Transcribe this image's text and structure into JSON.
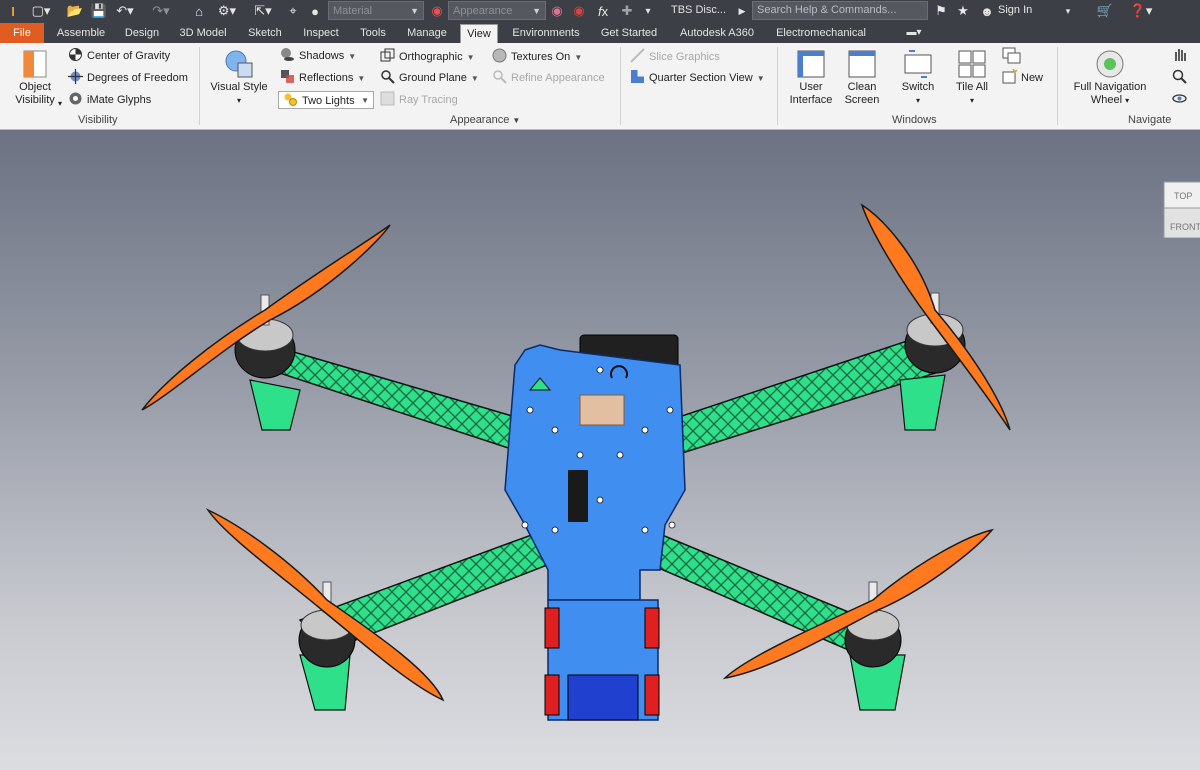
{
  "titlebar": {
    "material_combo": "Material",
    "appearance_combo": "Appearance",
    "document_title": "TBS Disc...",
    "search_placeholder": "Search Help & Commands...",
    "sign_in": "Sign In"
  },
  "tabs": [
    {
      "label": "File"
    },
    {
      "label": "Assemble"
    },
    {
      "label": "Design"
    },
    {
      "label": "3D Model"
    },
    {
      "label": "Sketch"
    },
    {
      "label": "Inspect"
    },
    {
      "label": "Tools"
    },
    {
      "label": "Manage"
    },
    {
      "label": "View"
    },
    {
      "label": "Environments"
    },
    {
      "label": "Get Started"
    },
    {
      "label": "Autodesk A360"
    },
    {
      "label": "Electromechanical"
    }
  ],
  "ribbon": {
    "visibility": {
      "title": "Visibility",
      "object_visibility": "Object Visibility",
      "object_visibility_l1": "Object",
      "object_visibility_l2": "Visibility",
      "center_of_gravity": "Center of Gravity",
      "degrees_of_freedom": "Degrees of Freedom",
      "imate_glyphs": "iMate Glyphs"
    },
    "appearance": {
      "title": "Appearance",
      "visual_style": "Visual Style",
      "shadows": "Shadows",
      "reflections": "Reflections",
      "two_lights": "Two Lights",
      "orthographic": "Orthographic",
      "ground_plane": "Ground Plane",
      "ray_tracing": "Ray Tracing",
      "textures_on": "Textures On",
      "refine_appearance": "Refine Appearance",
      "slice_graphics": "Slice Graphics",
      "quarter_section_view": "Quarter Section View"
    },
    "windows": {
      "title": "Windows",
      "user_interface_l1": "User",
      "user_interface_l2": "Interface",
      "clean_screen_l1": "Clean",
      "clean_screen_l2": "Screen",
      "switch": "Switch",
      "tile_all": "Tile All",
      "new": "New"
    },
    "navigate": {
      "title": "Navigate",
      "full_nav_wheel_l1": "Full Navigation",
      "full_nav_wheel_l2": "Wheel"
    }
  },
  "viewcube": {
    "top": "TOP",
    "front": "FRONT"
  },
  "colors": {
    "file_tab": "#e05c20",
    "frame_arms": "#2fe08a",
    "top_plate": "#3f8ef0",
    "propellers": "#ff7a1e",
    "motors": "#2a2a2a"
  }
}
